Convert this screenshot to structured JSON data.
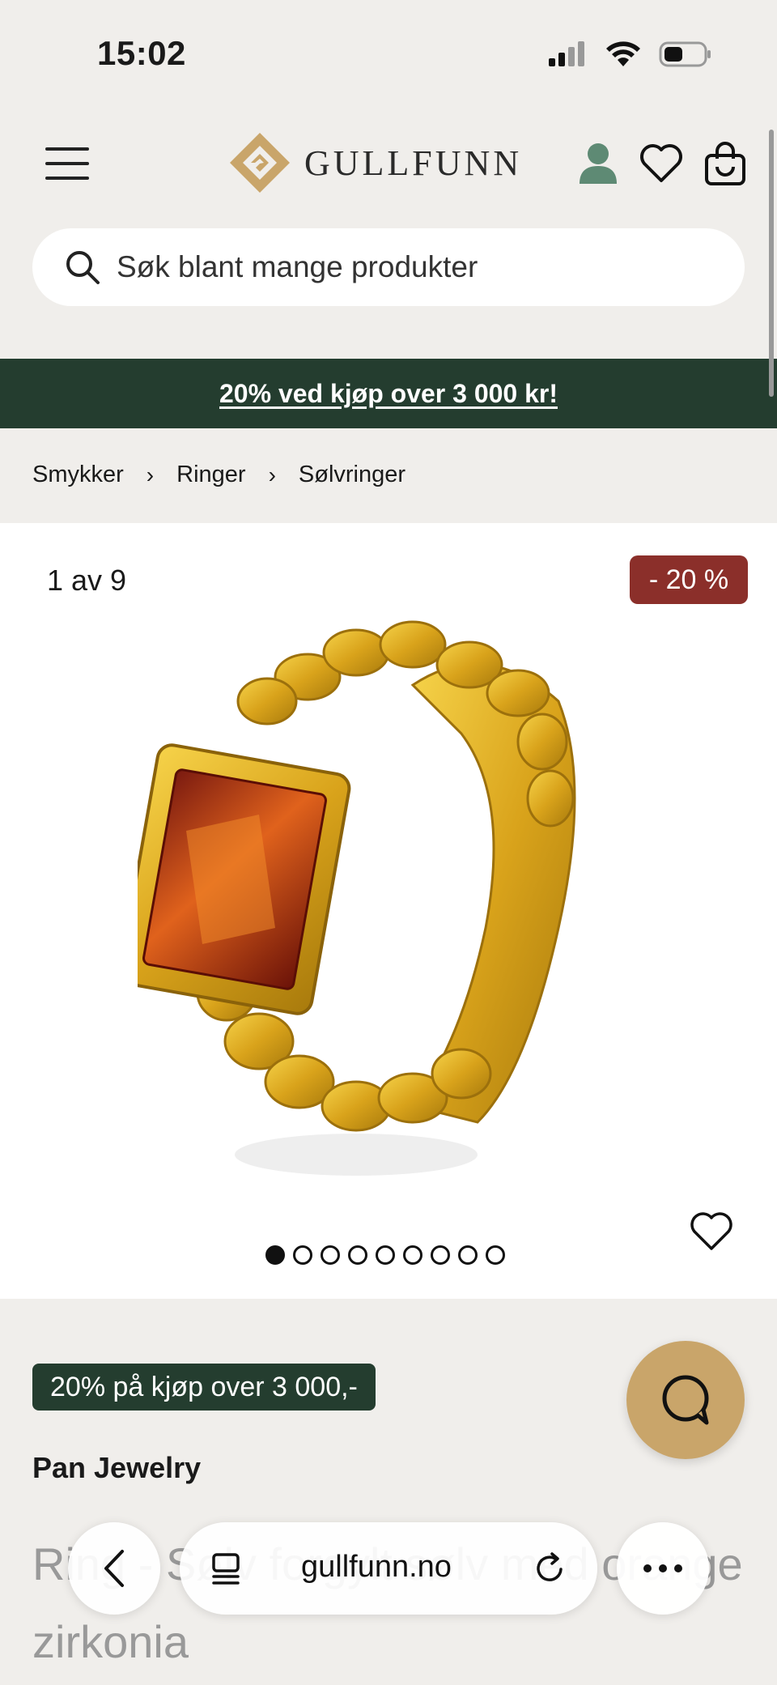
{
  "status": {
    "time": "15:02"
  },
  "header": {
    "logo_text": "GULLFUNN",
    "brand_color": "#c9a56a"
  },
  "search": {
    "placeholder": "Søk blant mange produkter"
  },
  "promo_banner": {
    "text": "20% ved kjøp over 3 000 kr!",
    "bg_color": "#243d2f"
  },
  "breadcrumb": {
    "items": [
      "Smykker",
      "Ringer",
      "Sølvringer"
    ]
  },
  "gallery": {
    "counter": "1 av 9",
    "discount": "- 20 %",
    "total_images": 9,
    "active_index": 0
  },
  "product": {
    "promo_tag": "20% på kjøp over 3 000,-",
    "brand": "Pan Jewelry",
    "title": "Ring - Sølv forgylt sølv med orange zirkonia"
  },
  "browser": {
    "url": "gullfunn.no"
  },
  "colors": {
    "green": "#243d2f",
    "discount_red": "#8b2f2a",
    "gold": "#c9a56a",
    "account_green": "#5e8a74"
  }
}
